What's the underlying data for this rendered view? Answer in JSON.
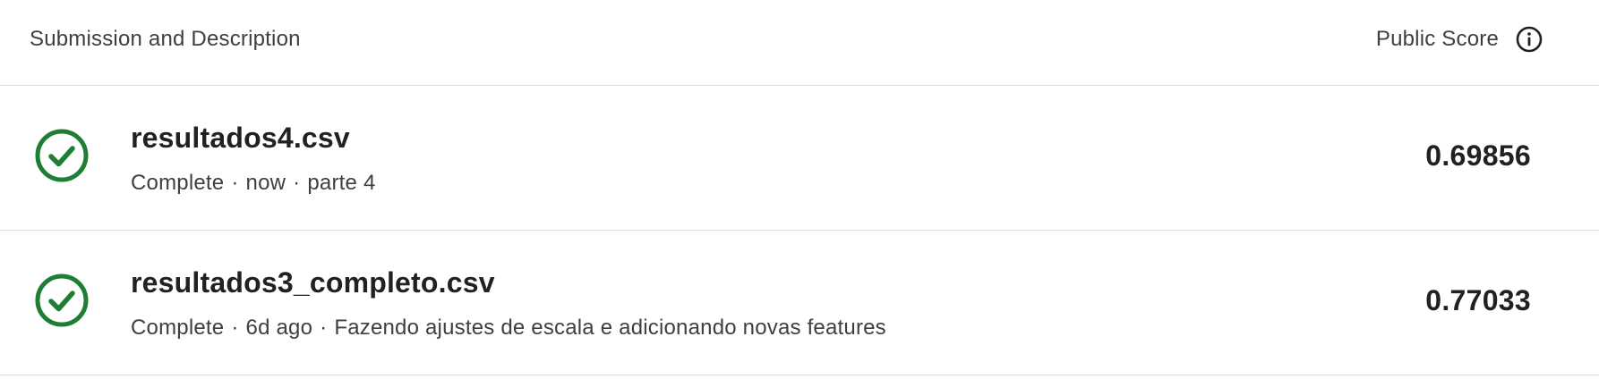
{
  "header": {
    "left_label": "Submission and Description",
    "right_label": "Public Score",
    "info_icon": "info-circle-icon"
  },
  "colors": {
    "success": "#1e7e34",
    "divider": "#dadce0",
    "text_primary": "#202124",
    "text_secondary": "#3c4043"
  },
  "submissions": [
    {
      "file_name": "resultados4.csv",
      "status": "Complete",
      "time": "now",
      "description": "parte 4",
      "score": "0.69856",
      "status_icon": "check-circle-icon"
    },
    {
      "file_name": "resultados3_completo.csv",
      "status": "Complete",
      "time": "6d ago",
      "description": "Fazendo ajustes de escala e adicionando novas features",
      "score": "0.77033",
      "status_icon": "check-circle-icon"
    }
  ]
}
